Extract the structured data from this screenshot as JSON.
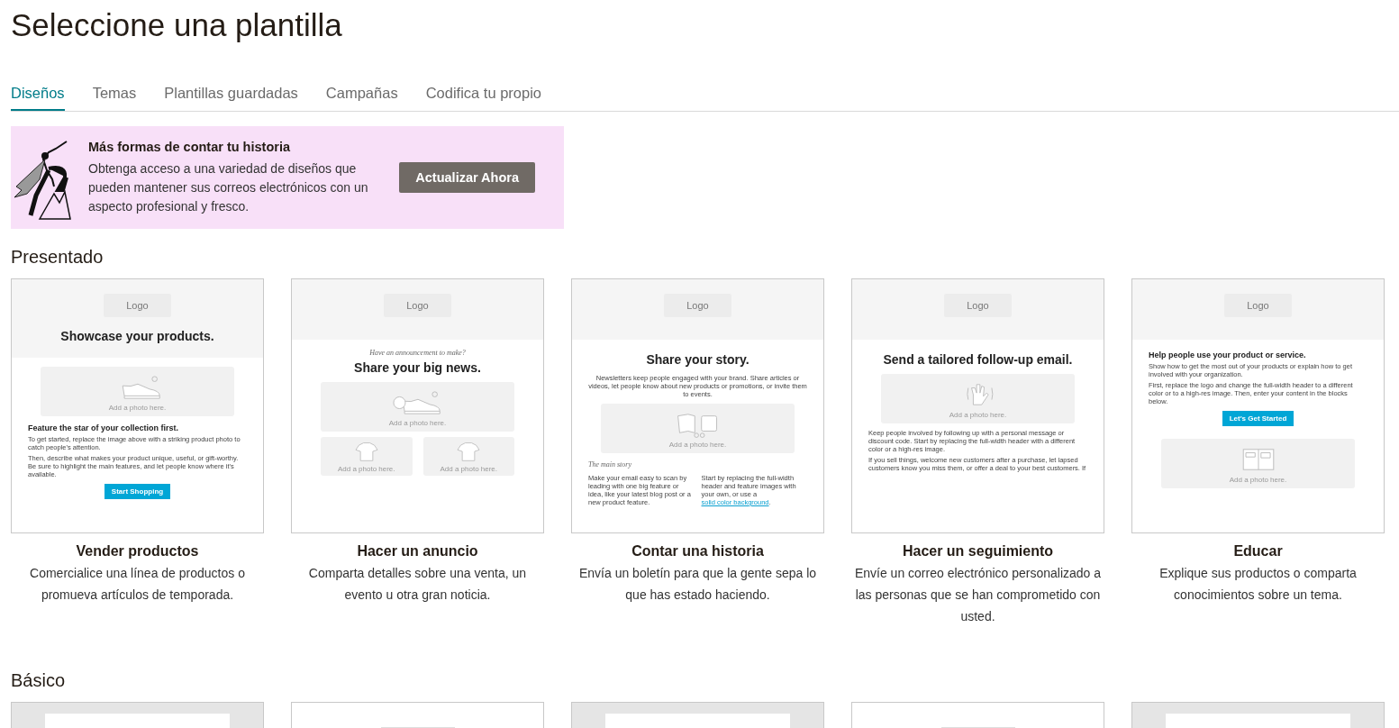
{
  "title": "Seleccione una plantilla",
  "tabs": [
    {
      "label": "Diseños",
      "selected": true
    },
    {
      "label": "Temas",
      "selected": false
    },
    {
      "label": "Plantillas guardadas",
      "selected": false
    },
    {
      "label": "Campañas",
      "selected": false
    },
    {
      "label": "Codifica tu propio",
      "selected": false
    }
  ],
  "banner": {
    "title": "Más formas de contar tu historia",
    "text": "Obtenga acceso a una variedad de diseños que pueden mantener sus correos electrónicos con un aspecto profesional y fresco.",
    "button": "Actualizar Ahora"
  },
  "featured": {
    "heading": "Presentado",
    "templates": [
      {
        "name": "Vender productos",
        "description": "Comercialice una línea de productos o promueva artículos de temporada.",
        "thumbnail": {
          "logo": "Logo",
          "header_title": "Showcase your products.",
          "blocks": [
            {
              "kind": "photo",
              "label": "Add a photo here."
            },
            {
              "kind": "subheading",
              "text": "Feature the star of your collection first."
            },
            {
              "kind": "paragraph",
              "text": "To get started, replace the image above with a striking product photo to catch people's attention."
            },
            {
              "kind": "paragraph",
              "text": "Then, describe what makes your product unique, useful, or gift-worthy. Be sure to highlight the main features, and let people know where it's available."
            },
            {
              "kind": "button",
              "text": "Start Shopping"
            }
          ]
        }
      },
      {
        "name": "Hacer un anuncio",
        "description": "Comparta detalles sobre una venta, un evento u otra gran noticia.",
        "thumbnail": {
          "logo": "Logo",
          "blocks": [
            {
              "kind": "kicker",
              "text": "Have an announcement to make?"
            },
            {
              "kind": "title",
              "text": "Share your big news."
            },
            {
              "kind": "photo",
              "label": "Add a photo here."
            },
            {
              "kind": "photo-pair",
              "labels": [
                "Add a photo here.",
                "Add a photo here."
              ]
            }
          ]
        }
      },
      {
        "name": "Contar una historia",
        "description": "Envía un boletín para que la gente sepa lo que has estado haciendo.",
        "thumbnail": {
          "logo": "Logo",
          "blocks": [
            {
              "kind": "title",
              "text": "Share your story."
            },
            {
              "kind": "intro",
              "text": "Newsletters keep people engaged with your brand. Share articles or videos, let people know about new products or promotions, or invite them to events."
            },
            {
              "kind": "photo",
              "label": "Add a photo here."
            },
            {
              "kind": "kicker-left",
              "text": "The main story"
            },
            {
              "kind": "columns",
              "left": "Make your email easy to scan by leading with one big feature or idea, like your latest blog post or a new product feature.",
              "right": "Start by replacing the full-width header and feature images with your own, or use a",
              "link": "solid color background",
              "after": "."
            }
          ]
        }
      },
      {
        "name": "Hacer un seguimiento",
        "description": "Envíe un correo electrónico personalizado a las personas que se han comprometido con usted.",
        "thumbnail": {
          "logo": "Logo",
          "blocks": [
            {
              "kind": "title",
              "text": "Send a tailored follow-up email."
            },
            {
              "kind": "photo",
              "label": "Add a photo here."
            },
            {
              "kind": "paragraph",
              "text": "Keep people involved by following up with a personal message or discount code. Start by replacing the full-width header with a different color or a high-res image."
            },
            {
              "kind": "paragraph",
              "text": "If you sell things, welcome new customers after a purchase, let lapsed customers know you miss them, or offer a deal to your best customers. If"
            }
          ]
        }
      },
      {
        "name": "Educar",
        "description": "Explique sus productos o comparta conocimientos sobre un tema.",
        "thumbnail": {
          "logo": "Logo",
          "blocks": [
            {
              "kind": "subheading",
              "text": "Help people use your product or service."
            },
            {
              "kind": "paragraph",
              "text": "Show how to get the most out of your products or explain how to get involved with your organization."
            },
            {
              "kind": "paragraph",
              "text": "First, replace the logo and change the full-width header to a different color or to a high-res image. Then, enter your content in the blocks below."
            },
            {
              "kind": "button",
              "text": "Let's Get Started"
            },
            {
              "kind": "photo",
              "label": "Add a photo here."
            }
          ]
        }
      }
    ]
  },
  "basic": {
    "heading": "Básico",
    "templates": [
      {
        "kind": "framed"
      },
      {
        "kind": "plain"
      },
      {
        "kind": "framed"
      },
      {
        "kind": "plain"
      },
      {
        "kind": "framed"
      }
    ]
  }
}
